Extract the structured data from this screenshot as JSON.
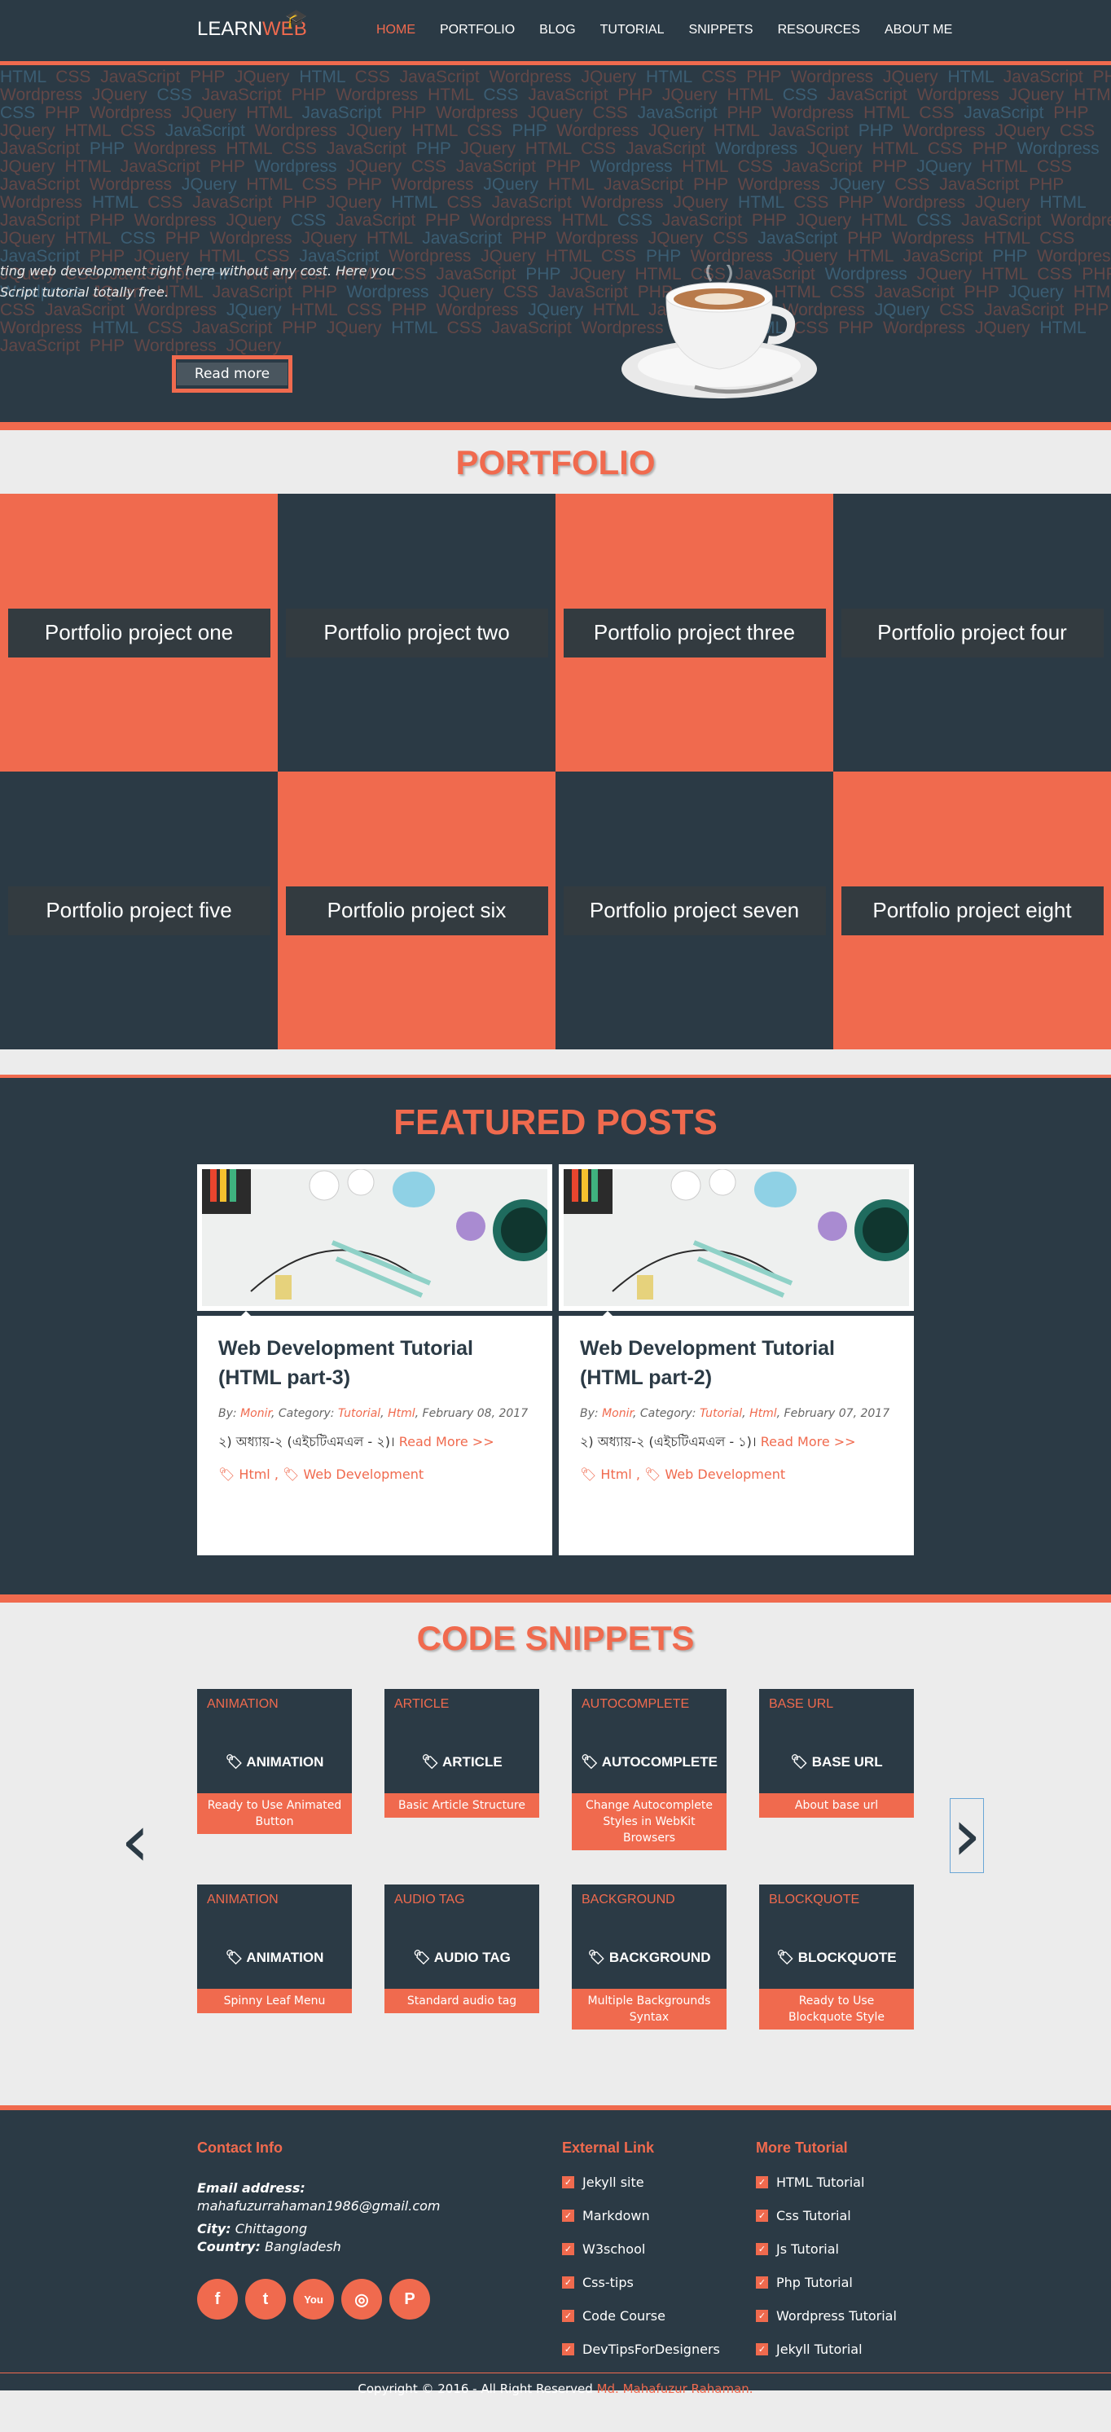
{
  "header": {
    "logo_learn": "LEARN",
    "logo_web": "WEB",
    "nav": [
      "HOME",
      "PORTFOLIO",
      "BLOG",
      "TUTORIAL",
      "SNIPPETS",
      "RESOURCES",
      "ABOUT ME"
    ]
  },
  "hero": {
    "line1": "ting web development right here without any cost. Here you",
    "line2": "Script tutorial totally free.",
    "read_more": "Read more",
    "bg_words": [
      "HTML",
      "CSS",
      "JavaScript",
      "PHP",
      "Wordpress",
      "JQuery"
    ]
  },
  "portfolio": {
    "title": "PORTFOLIO",
    "items": [
      "Portfolio project one",
      "Portfolio project two",
      "Portfolio project three",
      "Portfolio project four",
      "Portfolio project five",
      "Portfolio project six",
      "Portfolio project seven",
      "Portfolio project eight"
    ]
  },
  "featured": {
    "title": "FEATURED POSTS",
    "posts": [
      {
        "title": "Web Development Tutorial (HTML part-3)",
        "by": "By: ",
        "author": "Monir",
        "cat_label": ", Category: ",
        "cat1": "Tutorial",
        "cat2": "Html",
        "date": ", February 08, 2017",
        "excerpt": "২) অধ্যায়-২ (এইচটিএমএল - ২)।",
        "more": "Read More >>",
        "tag1": "Html",
        "tag2": "Web Development"
      },
      {
        "title": "Web Development Tutorial (HTML part-2)",
        "by": "By: ",
        "author": "Monir",
        "cat_label": ", Category: ",
        "cat1": "Tutorial",
        "cat2": "Html",
        "date": ", February 07, 2017",
        "excerpt": "২) অধ্যায়-২ (এইচটিএমএল - ১)।",
        "more": "Read More >>",
        "tag1": "Html",
        "tag2": "Web Development"
      }
    ]
  },
  "snippets": {
    "title": "CODE SNIPPETS",
    "items": [
      {
        "alt": "ANIMATION",
        "name": "ANIMATION",
        "caption": "Ready to Use Animated Button"
      },
      {
        "alt": "ARTICLE",
        "name": "ARTICLE",
        "caption": "Basic Article Structure"
      },
      {
        "alt": "AUTOCOMPLETE",
        "name": "AUTOCOMPLETE",
        "caption": "Change Autocomplete Styles in WebKit Browsers"
      },
      {
        "alt": "BASE URL",
        "name": "BASE URL",
        "caption": "About base url"
      },
      {
        "alt": "ANIMATION",
        "name": "ANIMATION",
        "caption": "Spinny Leaf Menu"
      },
      {
        "alt": "AUDIO TAG",
        "name": "AUDIO TAG",
        "caption": "Standard audio tag"
      },
      {
        "alt": "BACKGROUND",
        "name": "BACKGROUND",
        "caption": "Multiple Backgrounds Syntax"
      },
      {
        "alt": "BLOCKQUOTE",
        "name": "BLOCKQUOTE",
        "caption": "Ready to Use Blockquote Style"
      }
    ]
  },
  "footer": {
    "contact_title": "Contact Info",
    "email_label": "Email address:",
    "email": "mahafuzurrahaman1986@gmail.com",
    "city_label": "City:",
    "city": "Chittagong",
    "country_label": "Country:",
    "country": "Bangladesh",
    "socials": [
      "f",
      "t",
      "You",
      "◎",
      "P"
    ],
    "external_title": "External Link",
    "external": [
      "Jekyll site",
      "Markdown",
      "W3school",
      "Css-tips",
      "Code Course",
      "DevTipsForDesigners"
    ],
    "more_title": "More Tutorial",
    "more": [
      "HTML Tutorial",
      "Css Tutorial",
      "Js Tutorial",
      "Php Tutorial",
      "Wordpress Tutorial",
      "Jekyll Tutorial"
    ],
    "copyright": "Copyright © 2016 - All Right Reserved ",
    "owner": "Md. Mahafuzur Rahaman."
  },
  "colors": {
    "accent": "#f06a4e",
    "dark": "#2b3a45",
    "light": "#ececec"
  }
}
